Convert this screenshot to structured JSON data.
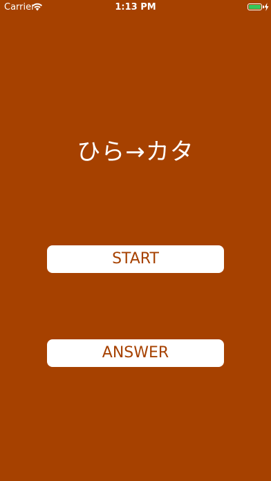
{
  "status_bar": {
    "carrier": "Carrier",
    "time": "1:13 PM",
    "battery_level": 1.0,
    "charging": true,
    "icons": [
      "wifi-icon",
      "battery-icon",
      "charging-icon"
    ]
  },
  "main": {
    "title": "ひら→カタ",
    "start_label": "START",
    "answer_label": "ANSWER"
  },
  "colors": {
    "background": "#A64100",
    "button_background": "#FFFFFF",
    "button_text": "#A64100",
    "title_text": "#FFFFFF",
    "battery_fill": "#34C759"
  }
}
